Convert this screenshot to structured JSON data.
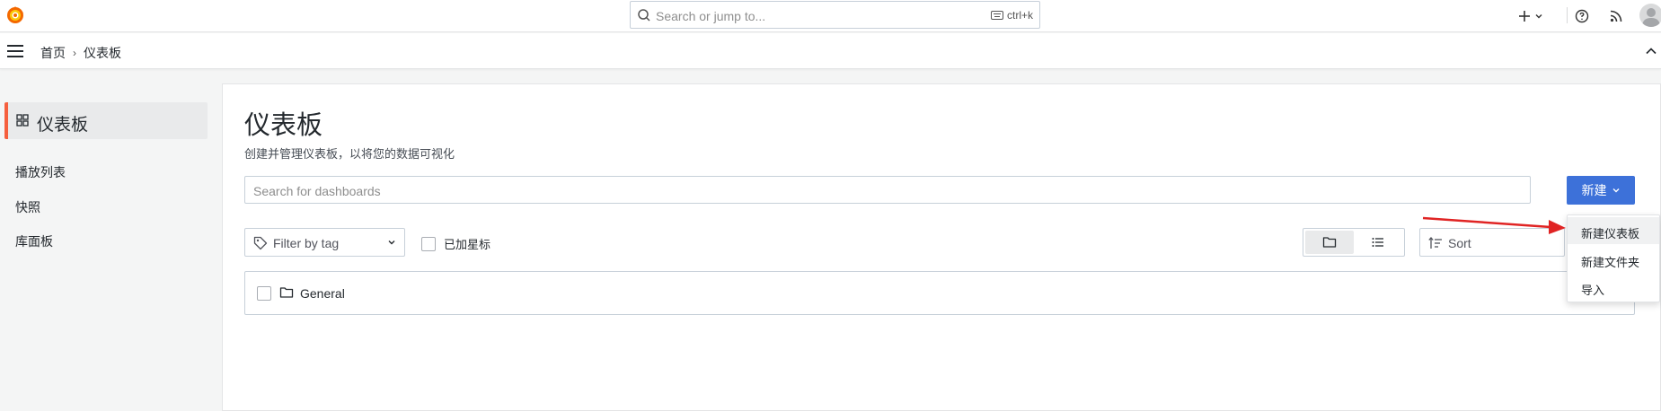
{
  "topbar": {
    "search_placeholder": "Search or jump to...",
    "shortcut": "ctrl+k",
    "icons": [
      "grafana-logo-icon",
      "search-icon",
      "keyboard-icon",
      "plus-icon",
      "chevron-down-icon",
      "help-icon",
      "rss-icon",
      "avatar-icon"
    ]
  },
  "breadcrumb": {
    "home": "首页",
    "current": "仪表板"
  },
  "sidebar": {
    "active": "仪表板",
    "items": [
      "播放列表",
      "快照",
      "库面板"
    ]
  },
  "main": {
    "title": "仪表板",
    "subtitle": "创建并管理仪表板，以将您的数据可视化",
    "search_placeholder": "Search for dashboards",
    "new_button": "新建",
    "tag_filter_placeholder": "Filter by tag",
    "starred_label": "已加星标",
    "sort_placeholder": "Sort",
    "folders": [
      {
        "name": "General"
      }
    ]
  },
  "new_menu": {
    "items": [
      "新建仪表板",
      "新建文件夹",
      "导入"
    ],
    "highlighted": "新建仪表板"
  },
  "colors": {
    "accent_orange": "#f55f3e",
    "primary_blue": "#3d71d9",
    "annotation_arrow": "#e02424"
  }
}
